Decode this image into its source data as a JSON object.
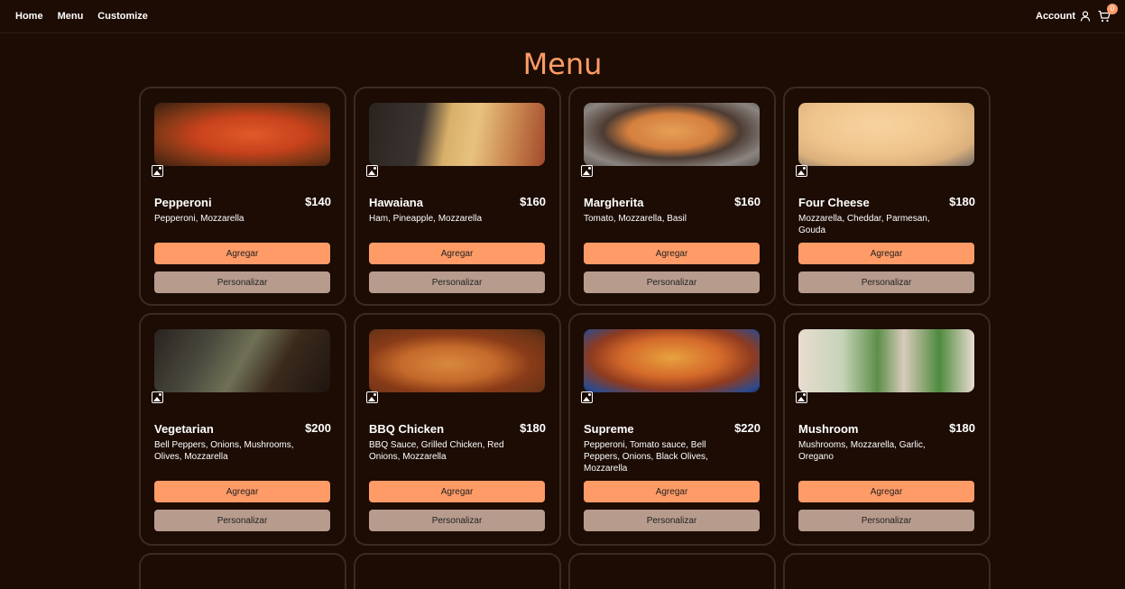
{
  "nav": {
    "items": [
      {
        "label": "Home"
      },
      {
        "label": "Menu"
      },
      {
        "label": "Customize"
      }
    ],
    "account_label": "Account",
    "cart_count": "0"
  },
  "page": {
    "title": "Menu"
  },
  "products": [
    {
      "name": "Pepperoni",
      "price": "$140",
      "description": "Pepperoni, Mozzarella",
      "add_label": "Agregar",
      "customize_label": "Personalizar"
    },
    {
      "name": "Hawaiana",
      "price": "$160",
      "description": "Ham, Pineapple, Mozzarella",
      "add_label": "Agregar",
      "customize_label": "Personalizar"
    },
    {
      "name": "Margherita",
      "price": "$160",
      "description": "Tomato, Mozzarella, Basil",
      "add_label": "Agregar",
      "customize_label": "Personalizar"
    },
    {
      "name": "Four Cheese",
      "price": "$180",
      "description": "Mozzarella, Cheddar, Parmesan, Gouda",
      "add_label": "Agregar",
      "customize_label": "Personalizar"
    },
    {
      "name": "Vegetarian",
      "price": "$200",
      "description": "Bell Peppers, Onions, Mushrooms, Olives, Mozzarella",
      "add_label": "Agregar",
      "customize_label": "Personalizar"
    },
    {
      "name": "BBQ Chicken",
      "price": "$180",
      "description": "BBQ Sauce, Grilled Chicken, Red Onions, Mozzarella",
      "add_label": "Agregar",
      "customize_label": "Personalizar"
    },
    {
      "name": "Supreme",
      "price": "$220",
      "description": "Pepperoni, Tomato sauce, Bell Peppers, Onions, Black Olives, Mozzarella",
      "add_label": "Agregar",
      "customize_label": "Personalizar"
    },
    {
      "name": "Mushroom",
      "price": "$180",
      "description": "Mushrooms, Mozzarella, Garlic, Oregano",
      "add_label": "Agregar",
      "customize_label": "Personalizar"
    }
  ],
  "colors": {
    "background": "#1c0c04",
    "accent": "#ff9b66",
    "secondary_button": "#b79c8e",
    "card_border": "#3a2c1f"
  },
  "icons": [
    "user-icon",
    "cart-icon",
    "image-icon"
  ]
}
